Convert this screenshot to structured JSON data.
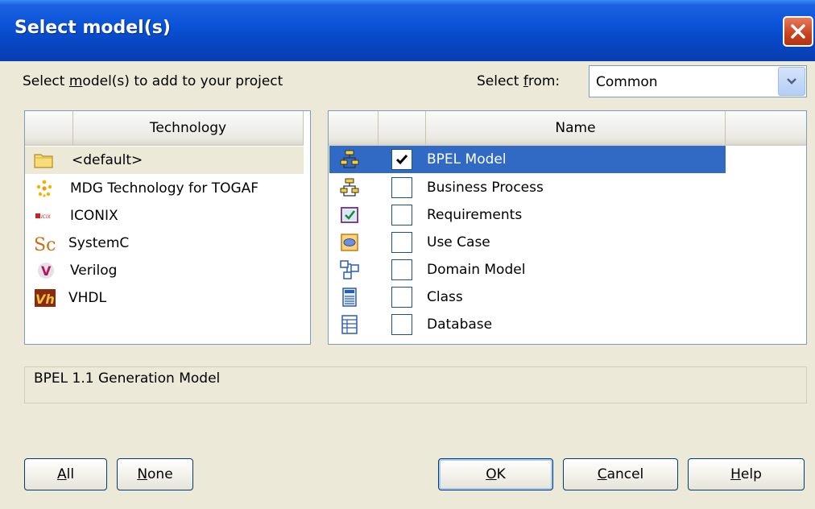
{
  "window": {
    "title": "Select model(s)"
  },
  "header": {
    "instruction": {
      "pre": "Select ",
      "key": "m",
      "post": "odel(s) to add to your project"
    },
    "select_from": {
      "pre": "Select ",
      "key": "f",
      "post": "rom:"
    },
    "combo_value": "Common"
  },
  "technology": {
    "column_header": "Technology",
    "items": [
      {
        "label": "<default>",
        "icon": "folder-icon"
      },
      {
        "label": "MDG Technology for TOGAF",
        "icon": "togaf-icon"
      },
      {
        "label": "ICONIX",
        "icon": "iconix-icon"
      },
      {
        "label": "SystemC",
        "icon": "systemc-icon"
      },
      {
        "label": "Verilog",
        "icon": "verilog-icon"
      },
      {
        "label": "VHDL",
        "icon": "vhdl-icon"
      }
    ]
  },
  "models": {
    "column_header": "Name",
    "items": [
      {
        "label": "BPEL Model",
        "checked": true,
        "icon": "bpel-icon"
      },
      {
        "label": "Business Process",
        "checked": false,
        "icon": "business-process-icon"
      },
      {
        "label": "Requirements",
        "checked": false,
        "icon": "requirements-icon"
      },
      {
        "label": "Use Case",
        "checked": false,
        "icon": "use-case-icon"
      },
      {
        "label": "Domain Model",
        "checked": false,
        "icon": "domain-model-icon"
      },
      {
        "label": "Class",
        "checked": false,
        "icon": "class-icon"
      },
      {
        "label": "Database",
        "checked": false,
        "icon": "database-icon"
      }
    ]
  },
  "description": "BPEL 1.1 Generation Model",
  "buttons": {
    "all": {
      "key": "A",
      "rest": "ll"
    },
    "none": {
      "key": "N",
      "rest": "one"
    },
    "ok": {
      "key": "O",
      "rest": "K"
    },
    "cancel": {
      "key": "C",
      "rest": "ancel"
    },
    "help": {
      "key": "H",
      "rest": "elp"
    }
  },
  "colors": {
    "selection": "#316ac5",
    "titlebar": "#0a53d8",
    "dialog": "#ece9d8"
  }
}
